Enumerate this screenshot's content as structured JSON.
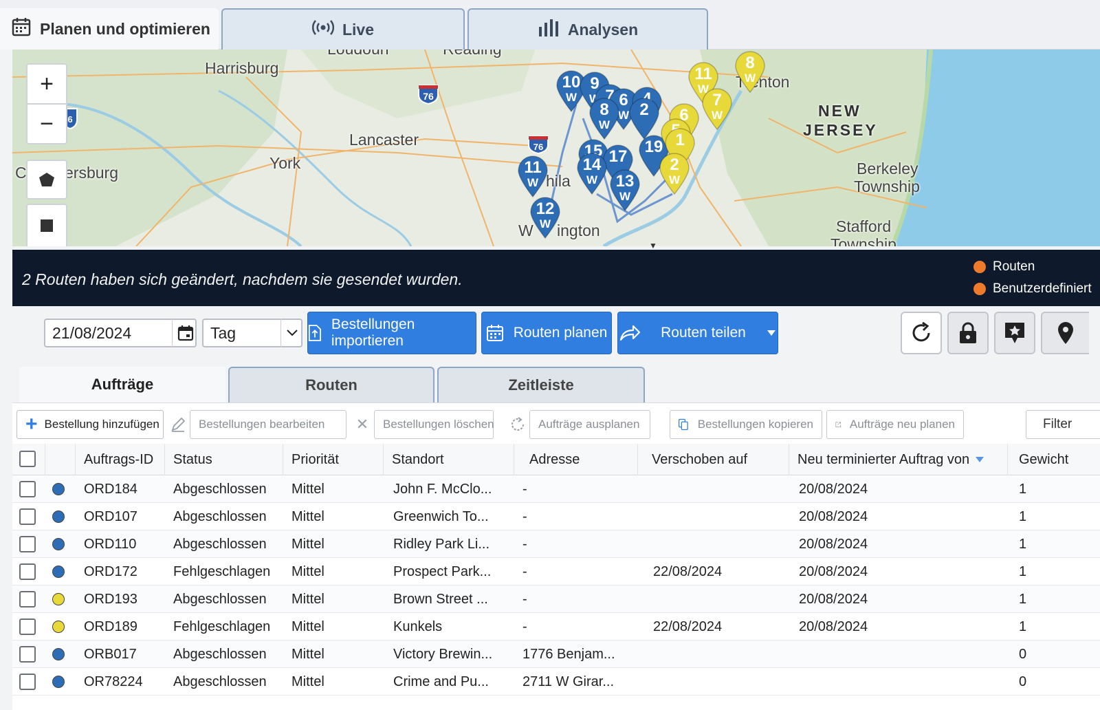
{
  "top_tabs": {
    "plan": {
      "label": "Planen und optimieren",
      "icon": "calendar-icon"
    },
    "live": {
      "label": "Live",
      "icon": "broadcast-icon"
    },
    "analysen": {
      "label": "Analysen",
      "icon": "bar-chart-icon"
    }
  },
  "map": {
    "labels": {
      "loudoun": "Loudoun",
      "reading": "Reading",
      "harrisburg": "Harrisburg",
      "trenton": "Trenton",
      "lancaster": "Lancaster",
      "new": "NEW",
      "jersey": "JERSEY",
      "chambersburg_c": "C",
      "chambersburg": "ersburg",
      "york": "York",
      "berkeley1": "Berkeley",
      "berkeley2": "Township",
      "stafford1": "Stafford",
      "stafford2": "Township",
      "philadelphia": "hila",
      "wilmington_a": "W",
      "wilmington_b": "ington"
    },
    "highways": {
      "i76_west": "76",
      "i76_east": "76",
      "i6": "6"
    },
    "controls": {
      "zoom_in": "+",
      "zoom_out": "−"
    },
    "blue_color": "#2d6db5",
    "yellow_color": "#e8d93a",
    "blue_pins": [
      {
        "num": "10",
        "sub": "W"
      },
      {
        "num": "9",
        "sub": "W"
      },
      {
        "num": "7",
        "sub": ""
      },
      {
        "num": "6",
        "sub": "W"
      },
      {
        "num": "8",
        "sub": "W"
      },
      {
        "num": "4",
        "sub": ""
      },
      {
        "num": "2",
        "sub": ""
      },
      {
        "num": "19",
        "sub": ""
      },
      {
        "num": "15",
        "sub": ""
      },
      {
        "num": "17",
        "sub": ""
      },
      {
        "num": "14",
        "sub": "W"
      },
      {
        "num": "13",
        "sub": "W"
      },
      {
        "num": "11",
        "sub": "W"
      },
      {
        "num": "12",
        "sub": "W"
      }
    ],
    "yellow_pins": [
      {
        "num": "8",
        "sub": "W"
      },
      {
        "num": "11",
        "sub": "W"
      },
      {
        "num": "7",
        "sub": "W"
      },
      {
        "num": "6",
        "sub": ""
      },
      {
        "num": "5",
        "sub": ""
      },
      {
        "num": "1",
        "sub": ""
      },
      {
        "num": "2",
        "sub": "W"
      }
    ]
  },
  "banner": {
    "message": "2 Routen haben sich geändert, nachdem sie gesendet wurden.",
    "legend": [
      {
        "label": "Routen",
        "color": "#f07a2c"
      },
      {
        "label": "Benutzerdefiniert",
        "color": "#f07a2c"
      }
    ]
  },
  "toolbar": {
    "date": "21/08/2024",
    "period": "Tag",
    "import_label": "Bestellungen importieren",
    "plan_label": "Routen planen",
    "share_label": "Routen teilen"
  },
  "sub_tabs": {
    "auftraege": "Aufträge",
    "routen": "Routen",
    "zeitleiste": "Zeitleiste"
  },
  "actions": {
    "add": "Bestellung hinzufügen",
    "edit": "Bestellungen bearbeiten",
    "delete": "Bestellungen löschen",
    "unplan": "Aufträge ausplanen",
    "copy": "Bestellungen kopieren",
    "replan": "Aufträge neu planen",
    "filter": "Filter"
  },
  "table": {
    "columns": {
      "id": "Auftrags-ID",
      "status": "Status",
      "prio": "Priorität",
      "standort": "Standort",
      "adresse": "Adresse",
      "verschoben": "Verschoben auf",
      "neu": "Neu terminierter Auftrag von",
      "gewicht": "Gewicht"
    },
    "rows": [
      {
        "dot": "#2d6db5",
        "id": "ORD184",
        "status": "Abgeschlossen",
        "prio": "Mittel",
        "standort": "John F. McClo...",
        "adresse": "-",
        "verschoben": "",
        "neu": "20/08/2024",
        "gewicht": "1"
      },
      {
        "dot": "#2d6db5",
        "id": "ORD107",
        "status": "Abgeschlossen",
        "prio": "Mittel",
        "standort": "Greenwich To...",
        "adresse": "-",
        "verschoben": "",
        "neu": "20/08/2024",
        "gewicht": "1"
      },
      {
        "dot": "#2d6db5",
        "id": "ORD110",
        "status": "Abgeschlossen",
        "prio": "Mittel",
        "standort": "Ridley Park Li...",
        "adresse": "-",
        "verschoben": "",
        "neu": "20/08/2024",
        "gewicht": "1"
      },
      {
        "dot": "#2d6db5",
        "id": "ORD172",
        "status": "Fehlgeschlagen",
        "prio": "Mittel",
        "standort": "Prospect Park...",
        "adresse": "-",
        "verschoben": "22/08/2024",
        "neu": "20/08/2024",
        "gewicht": "1"
      },
      {
        "dot": "#e8d93a",
        "id": "ORD193",
        "status": "Abgeschlossen",
        "prio": "Mittel",
        "standort": "Brown Street ...",
        "adresse": "-",
        "verschoben": "",
        "neu": "20/08/2024",
        "gewicht": "1"
      },
      {
        "dot": "#e8d93a",
        "id": "ORD189",
        "status": "Fehlgeschlagen",
        "prio": "Mittel",
        "standort": "Kunkels",
        "adresse": "-",
        "verschoben": "22/08/2024",
        "neu": "20/08/2024",
        "gewicht": "1"
      },
      {
        "dot": "#2d6db5",
        "id": "ORB017",
        "status": "Abgeschlossen",
        "prio": "Mittel",
        "standort": "Victory Brewin...",
        "adresse": "1776 Benjam...",
        "verschoben": "",
        "neu": "",
        "gewicht": "0"
      },
      {
        "dot": "#2d6db5",
        "id": "OR78224",
        "status": "Abgeschlossen",
        "prio": "Mittel",
        "standort": "Crime and Pu...",
        "adresse": "2711 W Girar...",
        "verschoben": "",
        "neu": "",
        "gewicht": "0"
      }
    ]
  }
}
